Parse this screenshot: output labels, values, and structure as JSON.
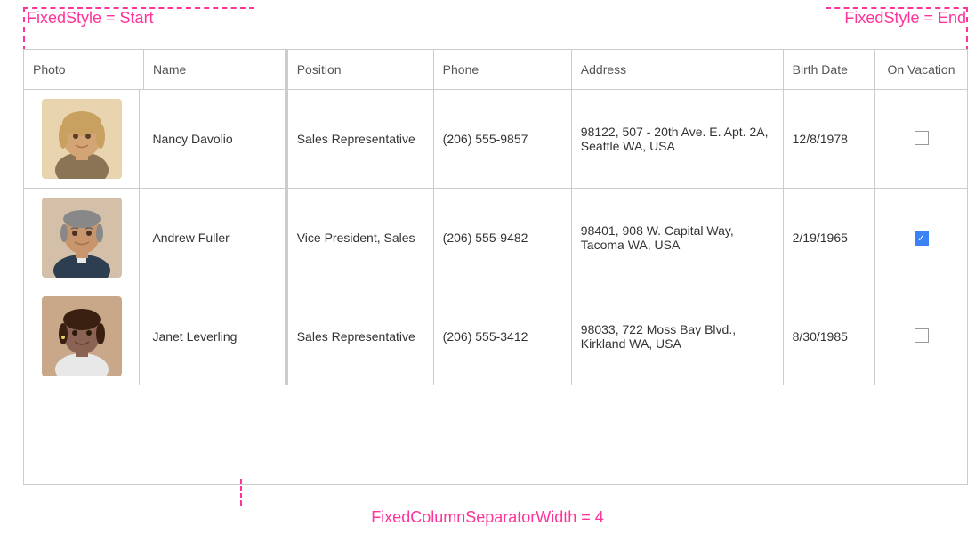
{
  "annotations": {
    "top_left": "FixedStyle = Start",
    "top_right": "FixedStyle = End",
    "bottom": "FixedColumnSeparatorWidth = 4"
  },
  "table": {
    "columns": [
      {
        "key": "photo",
        "label": "Photo"
      },
      {
        "key": "name",
        "label": "Name"
      },
      {
        "key": "position",
        "label": "Position"
      },
      {
        "key": "phone",
        "label": "Phone"
      },
      {
        "key": "address",
        "label": "Address"
      },
      {
        "key": "birthdate",
        "label": "Birth Date"
      },
      {
        "key": "vacation",
        "label": "On Vacation"
      }
    ],
    "rows": [
      {
        "id": 1,
        "name": "Nancy Davolio",
        "position": "Sales Representative",
        "phone": "(206) 555-9857",
        "address": "98122, 507 - 20th Ave. E. Apt. 2A, Seattle WA, USA",
        "birthdate": "12/8/1978",
        "on_vacation": false,
        "avatar_color_skin": "#d4a574",
        "avatar_color_hair": "#c8a060",
        "avatar_type": "female_blonde"
      },
      {
        "id": 2,
        "name": "Andrew Fuller",
        "position": "Vice President, Sales",
        "phone": "(206) 555-9482",
        "address": "98401, 908 W. Capital Way, Tacoma WA, USA",
        "birthdate": "2/19/1965",
        "on_vacation": true,
        "avatar_color_skin": "#c8956c",
        "avatar_color_hair": "#555",
        "avatar_type": "male_grey"
      },
      {
        "id": 3,
        "name": "Janet Leverling",
        "position": "Sales Representative",
        "phone": "(206) 555-3412",
        "address": "98033, 722 Moss Bay Blvd., Kirkland WA, USA",
        "birthdate": "8/30/1985",
        "on_vacation": false,
        "avatar_color_skin": "#8B6355",
        "avatar_color_hair": "#3a2010",
        "avatar_type": "female_dark"
      }
    ]
  }
}
